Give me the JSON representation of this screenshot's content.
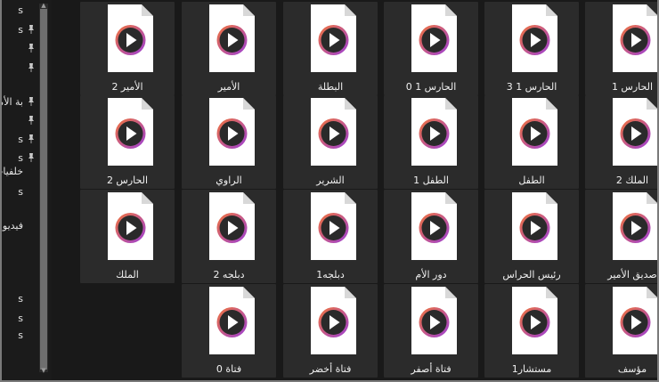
{
  "colors": {
    "accent": "#f0733a",
    "purple": "#9c3fd6",
    "background": "#191919",
    "tile": "#2b2b2b"
  },
  "sidebar": {
    "items": [
      {
        "label": "s",
        "pinned": false
      },
      {
        "label": "s",
        "pinned": true
      },
      {
        "label": "",
        "pinned": true
      },
      {
        "label": "",
        "pinned": true
      },
      {
        "label": "بة الأمير",
        "pinned": true
      },
      {
        "label": "",
        "pinned": true
      },
      {
        "label": "s",
        "pinned": true
      },
      {
        "label": "s",
        "pinned": true
      },
      {
        "label": "خلفيات ds",
        "pinned": false
      },
      {
        "label": "s",
        "pinned": false
      },
      {
        "label": "فيديو الأمير",
        "pinned": false
      },
      {
        "label": "",
        "pinned": false
      },
      {
        "label": "s",
        "pinned": false
      },
      {
        "label": "s",
        "pinned": false
      },
      {
        "label": "s",
        "pinned": false
      }
    ]
  },
  "files": [
    {
      "name": "الحارس 1",
      "icon": "video-file-icon"
    },
    {
      "name": "الحارس 1 3",
      "icon": "video-file-icon"
    },
    {
      "name": "الحارس 1 0",
      "icon": "video-file-icon"
    },
    {
      "name": "البطلة",
      "icon": "video-file-icon"
    },
    {
      "name": "الأمير",
      "icon": "video-file-icon"
    },
    {
      "name": "الأمير 2",
      "icon": "video-file-icon"
    },
    {
      "name": "الملك 2",
      "icon": "video-file-icon"
    },
    {
      "name": "الطفل",
      "icon": "video-file-icon"
    },
    {
      "name": "الطفل 1",
      "icon": "video-file-icon"
    },
    {
      "name": "الشرير",
      "icon": "video-file-icon"
    },
    {
      "name": "الراوي",
      "icon": "video-file-icon"
    },
    {
      "name": "الحارس 2",
      "icon": "video-file-icon"
    },
    {
      "name": "صديق الأمير",
      "icon": "video-file-icon"
    },
    {
      "name": "رئيس الحراس",
      "icon": "video-file-icon"
    },
    {
      "name": "دور الأم",
      "icon": "video-file-icon"
    },
    {
      "name": "دبلجه1",
      "icon": "video-file-icon"
    },
    {
      "name": "دبلجه 2",
      "icon": "video-file-icon"
    },
    {
      "name": "الملك",
      "icon": "video-file-icon"
    },
    {
      "name": "مؤسف",
      "icon": "video-file-icon"
    },
    {
      "name": "مستشار1",
      "icon": "video-file-icon"
    },
    {
      "name": "فتاة أصفر",
      "icon": "video-file-icon"
    },
    {
      "name": "فتاة أخضر",
      "icon": "video-file-icon"
    },
    {
      "name": "فتاة 0",
      "icon": "video-file-icon"
    }
  ]
}
